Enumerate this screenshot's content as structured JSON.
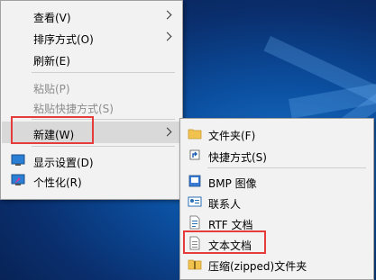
{
  "main_menu": {
    "items": [
      {
        "label": "查看(V)"
      },
      {
        "label": "排序方式(O)"
      },
      {
        "label": "刷新(E)"
      },
      {
        "label": "粘贴(P)"
      },
      {
        "label": "粘贴快捷方式(S)"
      },
      {
        "label": "新建(W)"
      },
      {
        "label": "显示设置(D)"
      },
      {
        "label": "个性化(R)"
      }
    ]
  },
  "new_submenu": {
    "items": [
      {
        "label": "文件夹(F)",
        "icon": "folder-icon"
      },
      {
        "label": "快捷方式(S)",
        "icon": "shortcut-icon"
      },
      {
        "label": "BMP 图像",
        "icon": "bmp-image-icon"
      },
      {
        "label": "联系人",
        "icon": "contact-icon"
      },
      {
        "label": "RTF 文档",
        "icon": "rtf-document-icon"
      },
      {
        "label": "文本文档",
        "icon": "text-document-icon"
      },
      {
        "label": "压缩(zipped)文件夹",
        "icon": "zip-folder-icon"
      }
    ]
  },
  "colors": {
    "highlight_box": "#e53b3b",
    "menu_bg": "#f2f2f2",
    "hover_bg": "#d9d9d9",
    "disabled_text": "#8c8c8c"
  }
}
